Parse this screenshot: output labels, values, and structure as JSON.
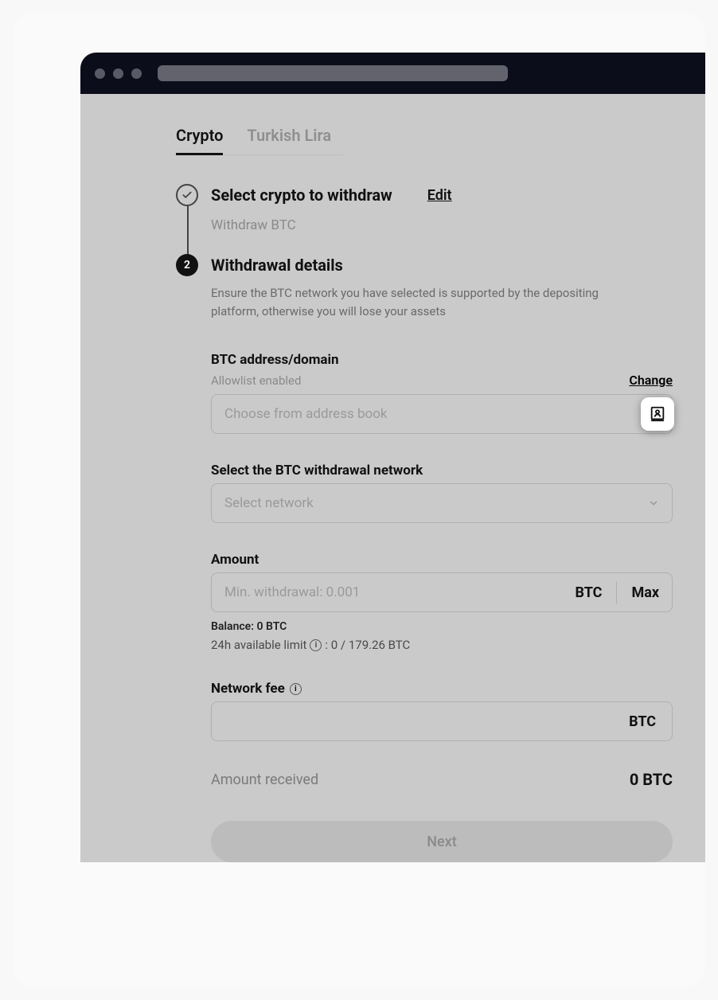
{
  "tabs": {
    "crypto": "Crypto",
    "fiat": "Turkish Lira"
  },
  "step1": {
    "title": "Select crypto to withdraw",
    "edit": "Edit",
    "subtitle": "Withdraw BTC"
  },
  "step2": {
    "number": "2",
    "title": "Withdrawal details",
    "description": "Ensure the BTC network you have selected is supported by the depositing platform, otherwise you will lose your assets"
  },
  "address": {
    "label": "BTC address/domain",
    "sublabel": "Allowlist enabled",
    "change": "Change",
    "placeholder": "Choose from address book"
  },
  "network": {
    "label": "Select the BTC withdrawal network",
    "placeholder": "Select network"
  },
  "amount": {
    "label": "Amount",
    "placeholder": "Min. withdrawal: 0.001",
    "unit": "BTC",
    "max": "Max",
    "balance": "Balance: 0 BTC",
    "limit_prefix": "24h available limit",
    "limit_value": ": 0 / 179.26 BTC"
  },
  "fee": {
    "label": "Network fee",
    "unit": "BTC"
  },
  "received": {
    "label": "Amount received",
    "value": "0 BTC"
  },
  "next": "Next"
}
